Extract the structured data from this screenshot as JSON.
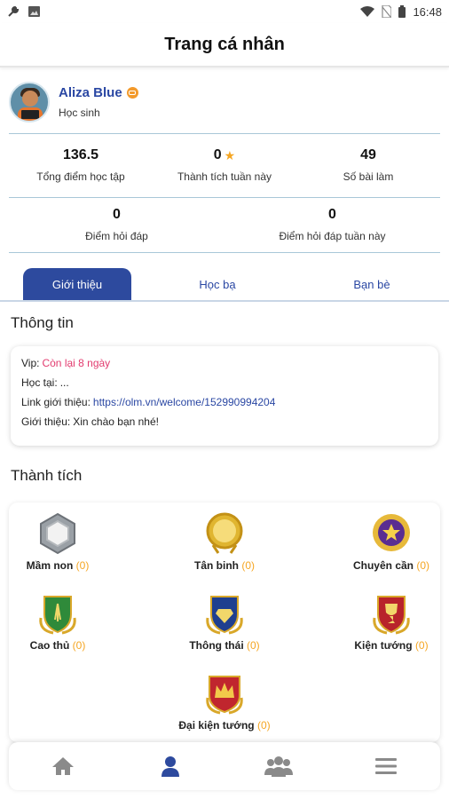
{
  "status_bar": {
    "time": "16:48"
  },
  "header": {
    "title": "Trang cá nhân"
  },
  "profile": {
    "name": "Aliza Blue",
    "role": "Học sinh"
  },
  "stats": [
    {
      "value": "136.5",
      "label": "Tổng điểm học tập"
    },
    {
      "value": "0",
      "label": "Thành tích tuần này"
    },
    {
      "value": "49",
      "label": "Số bài làm"
    },
    {
      "value": "0",
      "label": "Điểm hỏi đáp"
    },
    {
      "value": "0",
      "label": "Điểm hỏi đáp tuần này"
    }
  ],
  "tabs": [
    {
      "label": "Giới thiệu",
      "active": true
    },
    {
      "label": "Học bạ",
      "active": false
    },
    {
      "label": "Bạn bè",
      "active": false
    }
  ],
  "info": {
    "title": "Thông tin",
    "vip_label": "Vip:",
    "vip_value": "Còn lại 8 ngày",
    "school_label": "Học tại:",
    "school_value": "...",
    "link_label": "Link giới thiệu:",
    "link_value": "https://olm.vn/welcome/152990994204",
    "intro_label": "Giới thiệu:",
    "intro_value": "Xin chào bạn nhé!"
  },
  "achievements": {
    "title": "Thành tích",
    "items": [
      {
        "name": "Mầm non",
        "count": "(0)",
        "icon": "hexagon-badge-icon"
      },
      {
        "name": "Tân binh",
        "count": "(0)",
        "icon": "gold-medal-icon"
      },
      {
        "name": "Chuyên cần",
        "count": "(0)",
        "icon": "purple-star-medal-icon"
      },
      {
        "name": "Cao thủ",
        "count": "(0)",
        "icon": "green-shield-icon"
      },
      {
        "name": "Thông thái",
        "count": "(0)",
        "icon": "blue-diamond-shield-icon"
      },
      {
        "name": "Kiện tướng",
        "count": "(0)",
        "icon": "red-trophy-shield-icon"
      },
      {
        "name": "Đại kiện tướng",
        "count": "(0)",
        "icon": "red-crown-shield-icon"
      }
    ]
  },
  "bottom_nav": [
    {
      "icon": "home-icon",
      "active": false
    },
    {
      "icon": "person-icon",
      "active": true
    },
    {
      "icon": "group-icon",
      "active": false
    },
    {
      "icon": "menu-icon",
      "active": false
    }
  ],
  "colors": {
    "primary": "#2d4a9e",
    "accent": "#f5a623",
    "vip_pink": "#e23b6f",
    "divider": "#a9c7d8"
  }
}
